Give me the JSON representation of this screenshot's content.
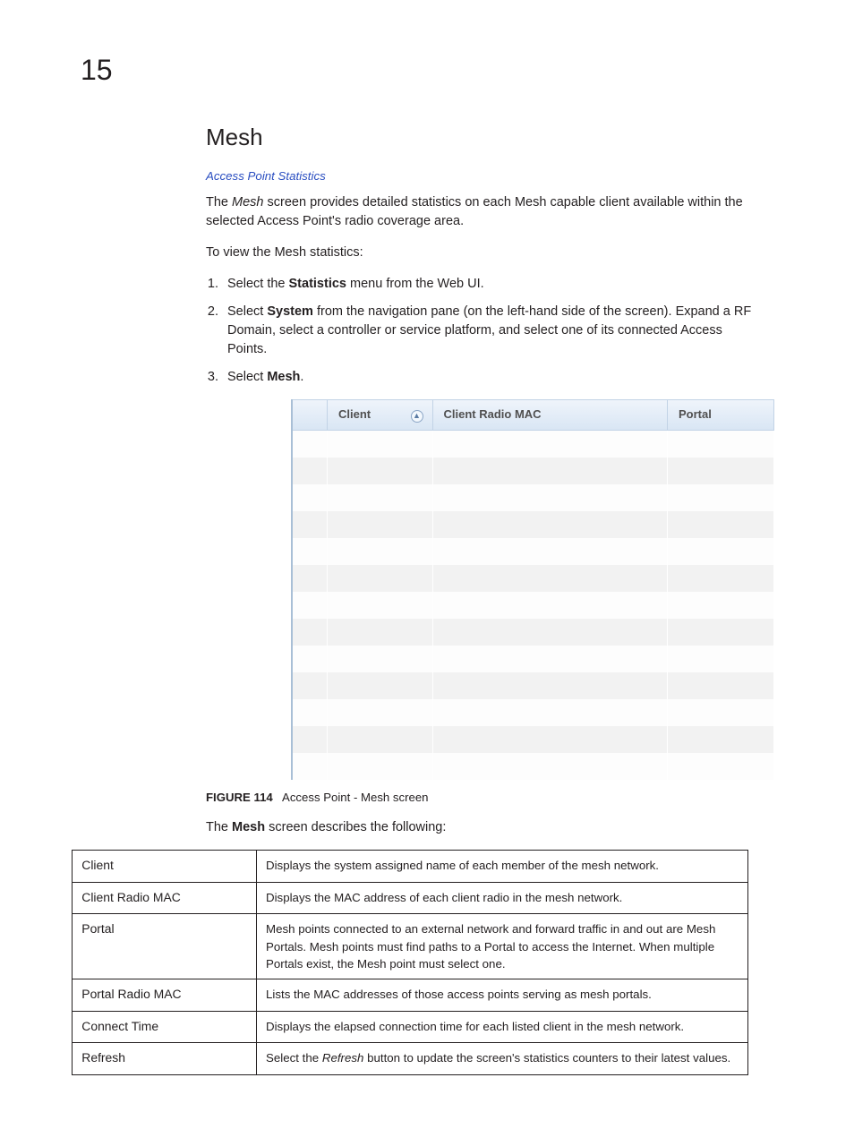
{
  "page": {
    "chapter_number": "15",
    "title": "Mesh",
    "subhead_link": "Access Point Statistics",
    "intro_pre": "The ",
    "intro_em": "Mesh",
    "intro_post": " screen provides detailed statistics on each Mesh capable client available within the selected Access Point's radio coverage area.",
    "view_intro": "To view the Mesh statistics:",
    "step1_pre": "Select the ",
    "step1_b": "Statistics",
    "step1_post": " menu from the Web UI.",
    "step2_pre": "Select ",
    "step2_b": "System",
    "step2_post": " from the navigation pane (on the left-hand side of the screen). Expand a RF Domain, select a controller or service platform, and select one of its connected Access Points.",
    "step3_pre": "Select ",
    "step3_b": "Mesh",
    "step3_post": ".",
    "figure_label": "FIGURE 114",
    "figure_caption": "Access Point - Mesh screen",
    "describes_pre": "The ",
    "describes_b": "Mesh",
    "describes_post": " screen describes the following:"
  },
  "fig_table": {
    "col_check": "",
    "col_client": "Client",
    "col_client_radio_mac": "Client Radio MAC",
    "col_portal": "Portal",
    "row_count": 13
  },
  "desc_rows": [
    {
      "term": "Client",
      "def": "Displays the system assigned name of each member of the mesh network."
    },
    {
      "term": "Client Radio MAC",
      "def": "Displays the MAC address of each client radio in the mesh network."
    },
    {
      "term": "Portal",
      "def": "Mesh points connected to an external network and forward traffic in and out are Mesh Portals. Mesh points must find paths to a Portal to access the Internet. When multiple Portals exist, the Mesh point must select one."
    },
    {
      "term": "Portal Radio MAC",
      "def": "Lists the MAC addresses of those access points serving as mesh portals."
    },
    {
      "term": "Connect Time",
      "def": "Displays the elapsed connection time for each listed client in the mesh network."
    },
    {
      "term": "Refresh",
      "def_pre": "Select the ",
      "def_em": "Refresh",
      "def_post": " button to update the screen's statistics counters to their latest values."
    }
  ]
}
